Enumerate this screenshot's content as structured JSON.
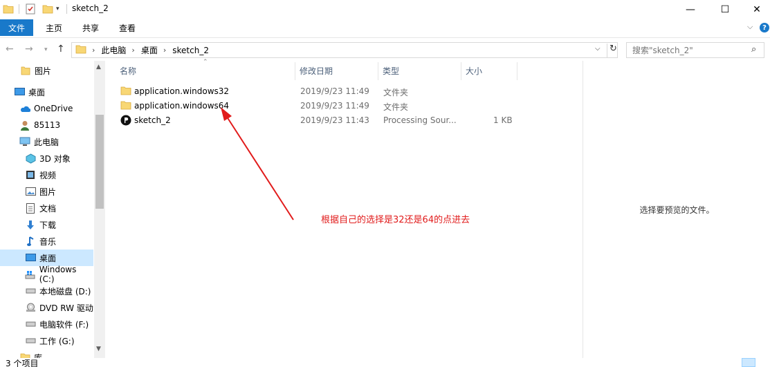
{
  "window": {
    "title": "sketch_2",
    "minimize": "—",
    "maximize": "☐",
    "close": "✕"
  },
  "ribbon": {
    "file": "文件",
    "home": "主页",
    "share": "共享",
    "view": "查看"
  },
  "address": {
    "crumbs": [
      "此电脑",
      "桌面",
      "sketch_2"
    ]
  },
  "search": {
    "placeholder": "搜索\"sketch_2\""
  },
  "sidebar": {
    "items": [
      {
        "label": "图片",
        "icon": "pictures-folder-icon"
      },
      {
        "label": "桌面",
        "icon": "desktop-icon"
      },
      {
        "label": "OneDrive",
        "icon": "onedrive-icon"
      },
      {
        "label": "85113",
        "icon": "user-icon"
      },
      {
        "label": "此电脑",
        "icon": "this-pc-icon"
      },
      {
        "label": "3D 对象",
        "icon": "3d-objects-icon"
      },
      {
        "label": "视频",
        "icon": "videos-icon"
      },
      {
        "label": "图片",
        "icon": "pictures-icon"
      },
      {
        "label": "文档",
        "icon": "documents-icon"
      },
      {
        "label": "下载",
        "icon": "downloads-icon"
      },
      {
        "label": "音乐",
        "icon": "music-icon"
      },
      {
        "label": "桌面",
        "icon": "desktop-icon"
      },
      {
        "label": "Windows (C:)",
        "icon": "windows-drive-icon"
      },
      {
        "label": "本地磁盘 (D:)",
        "icon": "drive-icon"
      },
      {
        "label": "DVD RW 驱动",
        "icon": "dvd-drive-icon"
      },
      {
        "label": "电脑软件 (F:)",
        "icon": "drive-icon"
      },
      {
        "label": "工作 (G:)",
        "icon": "drive-icon"
      },
      {
        "label": "库",
        "icon": "library-icon"
      }
    ]
  },
  "columns": {
    "name": "名称",
    "date": "修改日期",
    "type": "类型",
    "size": "大小"
  },
  "files": [
    {
      "name": "application.windows32",
      "date": "2019/9/23 11:49",
      "type": "文件夹",
      "size": "",
      "icon": "folder-icon"
    },
    {
      "name": "application.windows64",
      "date": "2019/9/23 11:49",
      "type": "文件夹",
      "size": "",
      "icon": "folder-icon"
    },
    {
      "name": "sketch_2",
      "date": "2019/9/23 11:43",
      "type": "Processing Sour...",
      "size": "1 KB",
      "icon": "processing-file-icon"
    }
  ],
  "preview": {
    "text": "选择要预览的文件。"
  },
  "annotation": {
    "text": "根据自己的选择是32还是64的点进去",
    "color": "#e11b1b"
  },
  "status": {
    "text": "3 个项目"
  },
  "colors": {
    "accent": "#1979ca",
    "selection": "#cce8ff",
    "folder": "#f8d775"
  }
}
